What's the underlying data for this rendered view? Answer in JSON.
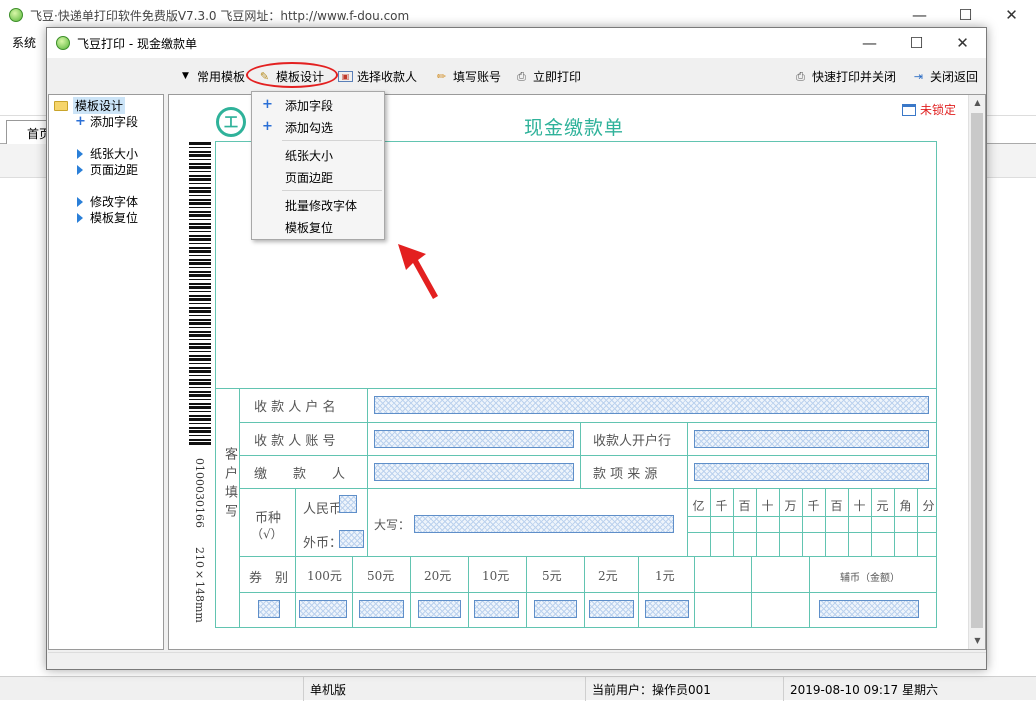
{
  "outer": {
    "title": "飞豆·快递单打印软件免费版V7.3.0  飞豆网址：http://www.f-dou.com",
    "menu_system": "系统",
    "tab_home": "首页",
    "minimize": "—",
    "maximize": "☐",
    "close": "✕"
  },
  "status_bar": {
    "edition": "单机版",
    "current_user": "当前用户：操作员001",
    "datetime": "2019-08-10 09:17 星期六"
  },
  "dialog": {
    "title": "飞豆打印 - 现金缴款单",
    "minimize": "—",
    "maximize": "☐",
    "close": "✕"
  },
  "toolbar": {
    "common_templates": "常用模板",
    "template_design": "模板设计",
    "select_payee": "选择收款人",
    "fill_account": "填写账号",
    "print_now": "立即打印",
    "quick_print_close": "快速打印并关闭",
    "close_return": "关闭返回"
  },
  "tree": {
    "root": "模板设计",
    "items": [
      "添加字段",
      "纸张大小",
      "页面边距",
      "修改字体",
      "模板复位"
    ]
  },
  "dropdown": {
    "items": [
      "添加字段",
      "添加勾选",
      "纸张大小",
      "页面边距",
      "批量修改字体",
      "模板复位"
    ]
  },
  "form": {
    "title": "现金缴款单",
    "lock_status": "未锁定",
    "logo_char": "工",
    "side_code": "0100030166",
    "side_size": "210×148mm",
    "client_fill": "客户填写",
    "payee_name": "收 款 人 户 名",
    "payee_account": "收 款 人 账 号",
    "payee_bank": "收款人开户行",
    "payer": "缴　　款　　人",
    "source": "款 项 来 源",
    "currency": "币种",
    "currency_check": "（√）",
    "rmb": "人民币",
    "foreign": "外币：",
    "capital": "大写：",
    "denomination": "券　别",
    "denoms": [
      "100元",
      "50元",
      "20元",
      "10元",
      "5元",
      "2元",
      "1元"
    ],
    "coins": "辅币（金额）",
    "digits": [
      "亿",
      "千",
      "百",
      "十",
      "万",
      "千",
      "百",
      "十",
      "元",
      "角",
      "分"
    ]
  },
  "colors": {
    "form_line": "#62c4b1",
    "form_title": "#2fb29a",
    "highlight_ring": "#e32020",
    "arrow": "#e32020"
  }
}
